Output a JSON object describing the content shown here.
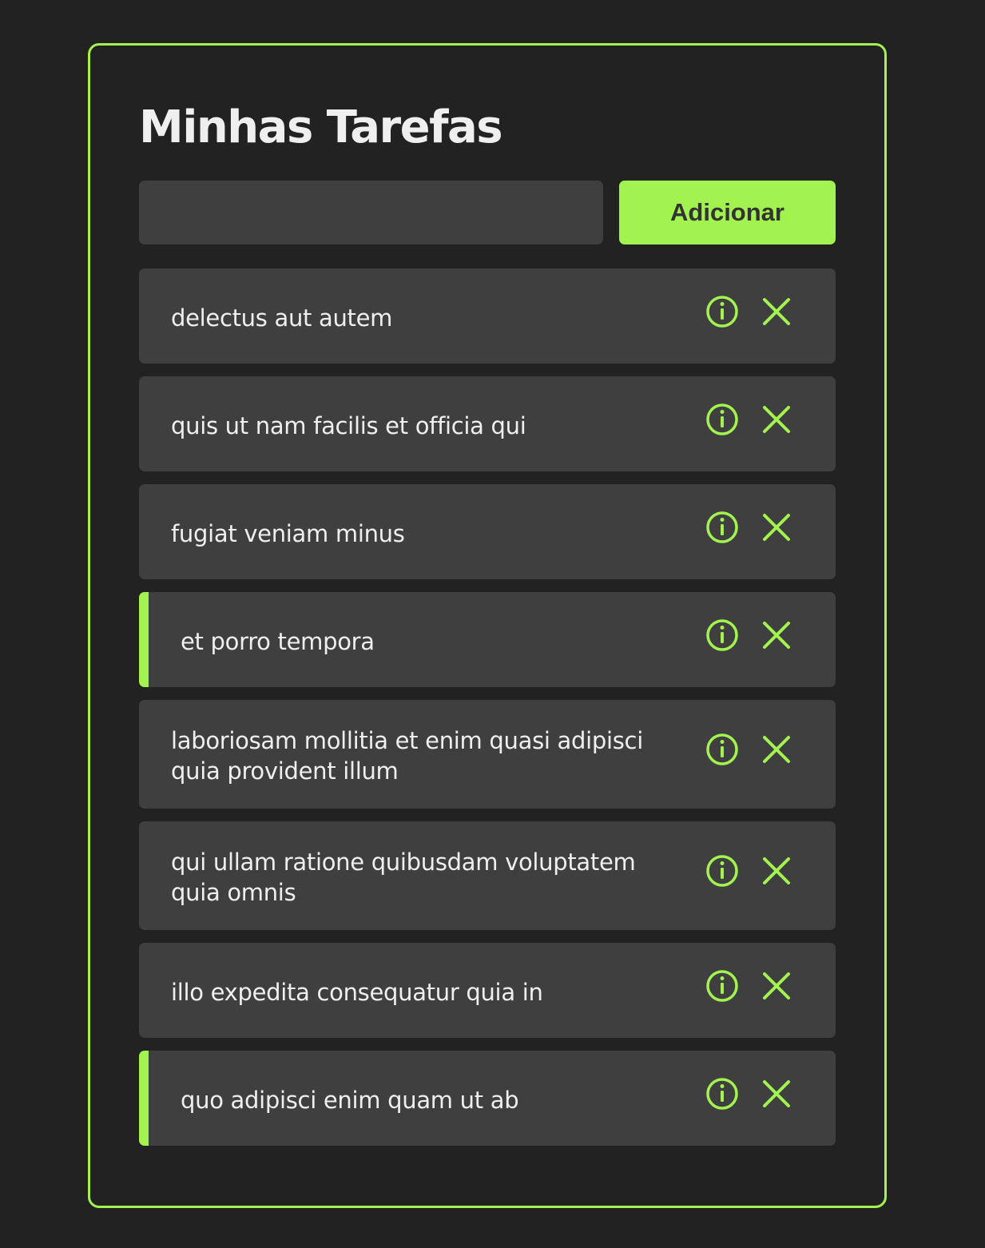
{
  "app": {
    "title": "Minhas Tarefas"
  },
  "form": {
    "input_value": "",
    "add_label": "Adicionar"
  },
  "colors": {
    "accent": "#a3f350",
    "background": "#222222",
    "card": "#3f3f3f",
    "text": "#efefef"
  },
  "icons": {
    "info": "info-circle-icon",
    "remove": "close-x-icon"
  },
  "tasks": [
    {
      "label": "delectus aut autem",
      "completed": false
    },
    {
      "label": "quis ut nam facilis et officia qui",
      "completed": false
    },
    {
      "label": "fugiat veniam minus",
      "completed": false
    },
    {
      "label": "et porro tempora",
      "completed": true
    },
    {
      "label": "laboriosam mollitia et enim quasi adipisci quia provident illum",
      "completed": false
    },
    {
      "label": "qui ullam ratione quibusdam voluptatem quia omnis",
      "completed": false
    },
    {
      "label": "illo expedita consequatur quia in",
      "completed": false
    },
    {
      "label": "quo adipisci enim quam ut ab",
      "completed": true
    }
  ]
}
